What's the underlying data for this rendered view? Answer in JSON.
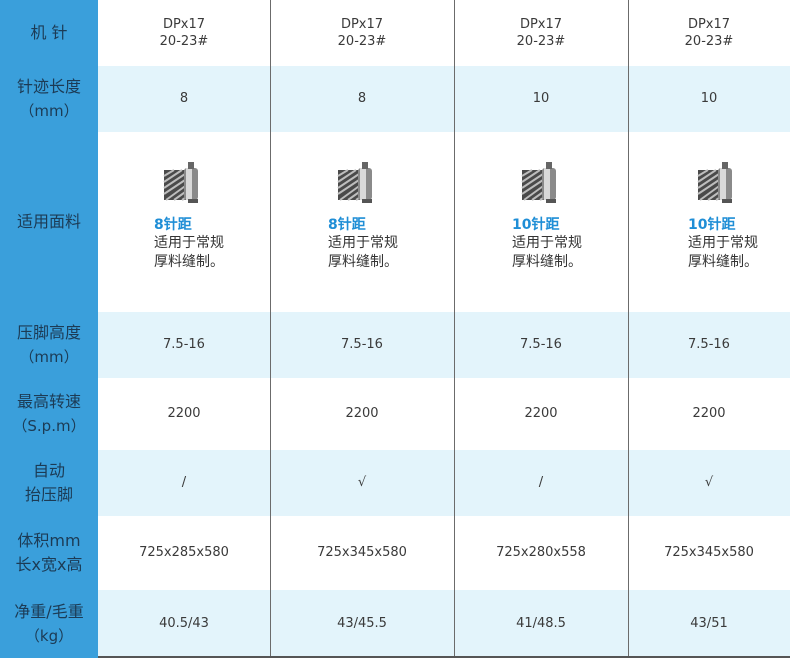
{
  "rows": [
    {
      "label": [
        "机 针",
        ""
      ],
      "values": [
        [
          "DPx17",
          "20-23#"
        ],
        [
          "DPx17",
          "20-23#"
        ],
        [
          "DPx17",
          "20-23#"
        ],
        [
          "DPx17",
          "20-23#"
        ]
      ]
    },
    {
      "label": [
        "针迹长度",
        "（mm）"
      ],
      "values": [
        "8",
        "8",
        "10",
        "10"
      ]
    },
    {
      "label": [
        "适用面料",
        ""
      ],
      "fabrics": [
        {
          "pitch": "8针距",
          "desc1": "适用于常规",
          "desc2": "厚料缝制。"
        },
        {
          "pitch": "8针距",
          "desc1": "适用于常规",
          "desc2": "厚料缝制。"
        },
        {
          "pitch": "10针距",
          "desc1": "适用于常规",
          "desc2": "厚料缝制。"
        },
        {
          "pitch": "10针距",
          "desc1": "适用于常规",
          "desc2": "厚料缝制。"
        }
      ]
    },
    {
      "label": [
        "压脚高度",
        "（mm）"
      ],
      "values": [
        "7.5-16",
        "7.5-16",
        "7.5-16",
        "7.5-16"
      ]
    },
    {
      "label": [
        "最高转速",
        "（S.p.m）"
      ],
      "values": [
        "2200",
        "2200",
        "2200",
        "2200"
      ]
    },
    {
      "label": [
        "自动",
        "抬压脚"
      ],
      "values": [
        "/",
        "√",
        "/",
        "√"
      ]
    },
    {
      "label": [
        "体积mm",
        "长x宽x高"
      ],
      "values": [
        "725x285x580",
        "725x345x580",
        "725x280x558",
        "725x345x580"
      ]
    },
    {
      "label": [
        "净重/毛重",
        "（kg）"
      ],
      "values": [
        "40.5/43",
        "43/45.5",
        "41/48.5",
        "43/51"
      ]
    }
  ],
  "colors": {
    "label_bg": "#3a9fdb",
    "stripe_bg": "#e3f4fb",
    "accent": "#1f8ed6"
  },
  "icons": {
    "fabric": "fabric-roll-icon"
  }
}
